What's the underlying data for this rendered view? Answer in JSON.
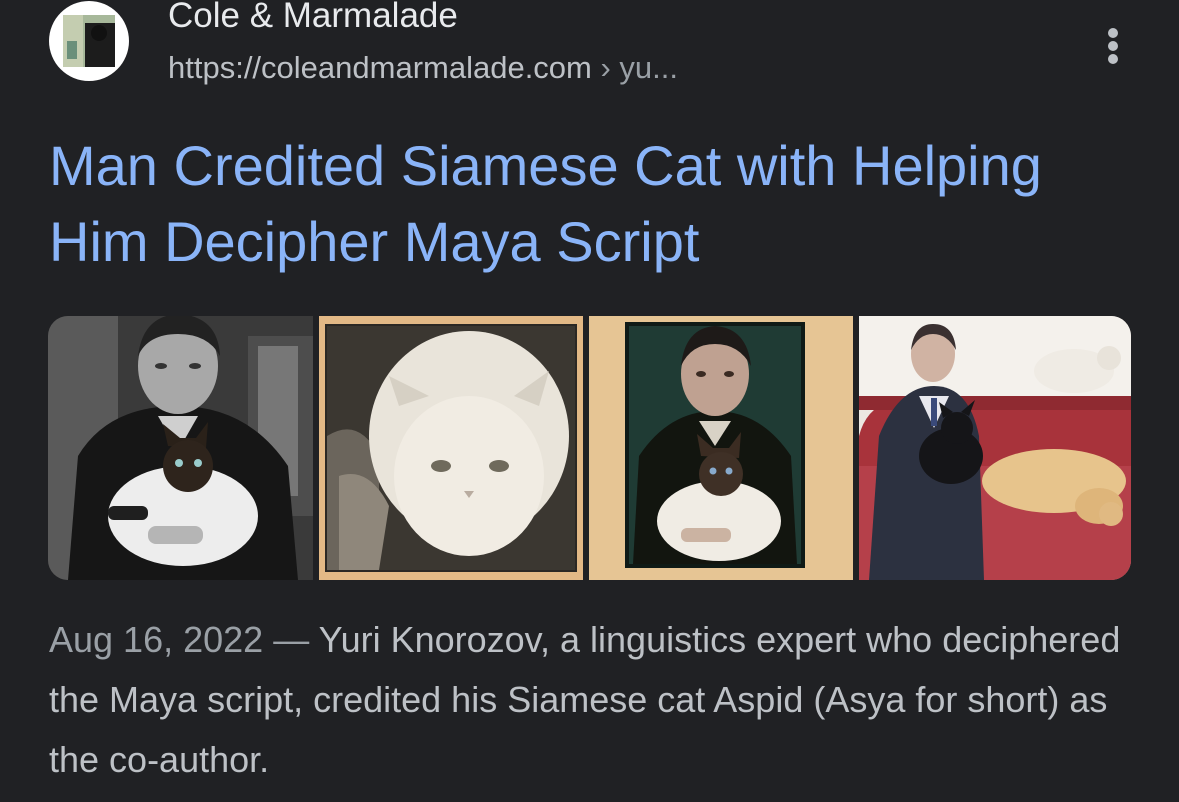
{
  "result": {
    "site_name": "Cole & Marmalade",
    "site_url": "https://coleandmarmalade.com",
    "url_crumb": " › yu...",
    "favicon_icon": "cat-photo-favicon",
    "more_icon": "more-vert-icon",
    "title": "Man Credited Siamese Cat with Helping Him Decipher Maya Script",
    "images": [
      {
        "icon": "man-holding-siamese-cat-bw-photo"
      },
      {
        "icon": "white-cat-sepia-photo"
      },
      {
        "icon": "man-holding-siamese-cat-color-photo"
      },
      {
        "icon": "man-on-red-sofa-with-cats-photo"
      }
    ],
    "date": "Aug 16, 2022",
    "separator": " — ",
    "snippet": "Yuri Knorozov, a linguistics expert who deciphered the Maya script, credited his Siamese cat Aspid (Asya for short) as the co-author."
  },
  "colors": {
    "background": "#202124",
    "title_link": "#8ab4f8",
    "site_name": "#e8eaed",
    "body_text": "#bdc1c6",
    "muted_text": "#9aa0a6"
  }
}
